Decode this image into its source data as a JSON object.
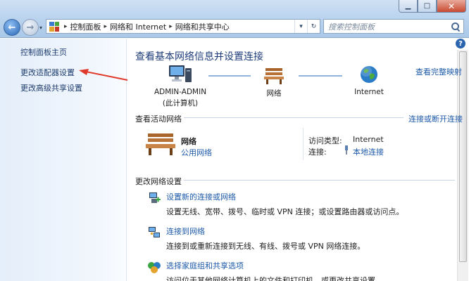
{
  "window": {
    "minimize_glyph": "▁",
    "maximize_glyph": "□",
    "close_glyph": "✕"
  },
  "address_bar": {
    "crumbs": [
      "控制面板",
      "网络和 Internet",
      "网络和共享中心"
    ],
    "refresh_glyph": "↻",
    "dropdown_glyph": "▾"
  },
  "search": {
    "placeholder": "搜索控制面板"
  },
  "sidebar": {
    "items": [
      {
        "label": "控制面板主页"
      },
      {
        "label": "更改适配器设置"
      },
      {
        "label": "更改高级共享设置"
      }
    ]
  },
  "main": {
    "title": "查看基本网络信息并设置连接",
    "view_full_map": "查看完整映射",
    "help_glyph": "?",
    "network_map": {
      "computer_name": "ADMIN-ADMIN",
      "computer_sub": "(此计算机)",
      "network_label": "网络",
      "internet_label": "Internet"
    },
    "active": {
      "section_title": "查看活动网络",
      "connect_link": "连接或断开连接",
      "network_name": "网络",
      "network_type": "公用网络",
      "access_type_label": "访问类型:",
      "access_type_value": "Internet",
      "connection_label": "连接:",
      "connection_value": "本地连接"
    },
    "change": {
      "section_title": "更改网络设置",
      "tasks": [
        {
          "title": "设置新的连接或网络",
          "desc": "设置无线、宽带、拨号、临时或 VPN 连接；或设置路由器或访问点。"
        },
        {
          "title": "连接到网络",
          "desc": "连接到或重新连接到无线、有线、拨号或 VPN 网络连接。"
        },
        {
          "title": "选择家庭组和共享选项",
          "desc": "访问位于其他网络计算机上的文件和打印机，或更改共享设置。"
        }
      ]
    }
  },
  "colors": {
    "link": "#1d5aa8",
    "title": "#1e3d7a",
    "annotation_arrow": "#e0392b"
  }
}
